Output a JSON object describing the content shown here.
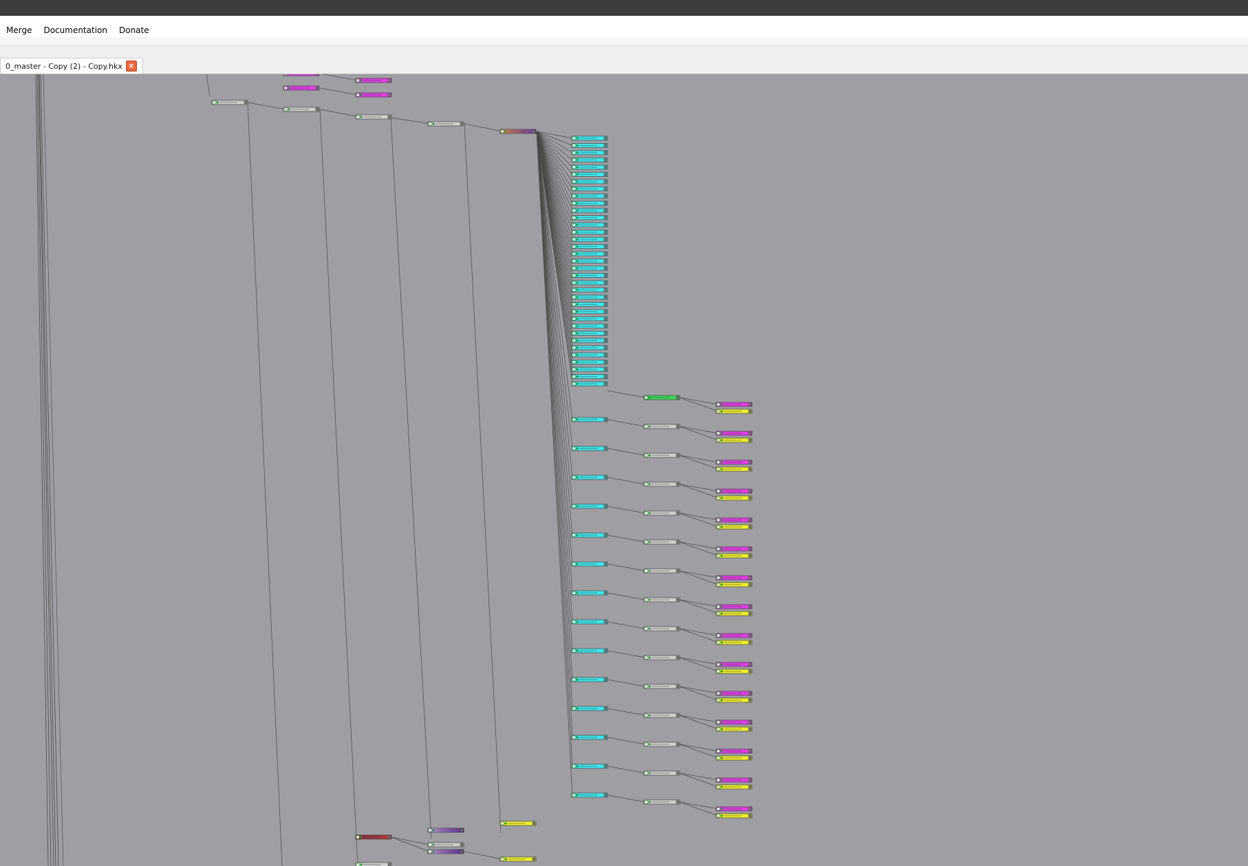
{
  "window": {
    "title": ""
  },
  "menu": {
    "merge": "Merge",
    "documentation": "Documentation",
    "donate": "Donate"
  },
  "tabs": [
    {
      "label": "0_master - Copy (2) - Copy.hkx",
      "close_icon": "close-icon"
    }
  ],
  "colors": {
    "canvas": "#9e9ea3",
    "node_gray": "#cfcfcf",
    "node_cyan": "#3ee8ee",
    "node_magenta": "#e23ee6",
    "node_yellow": "#f0f02c",
    "node_green": "#3ed85a",
    "node_purple": "#6a3ca6",
    "node_darkred": "#8a2a36",
    "edge": "#4a4a4a"
  }
}
